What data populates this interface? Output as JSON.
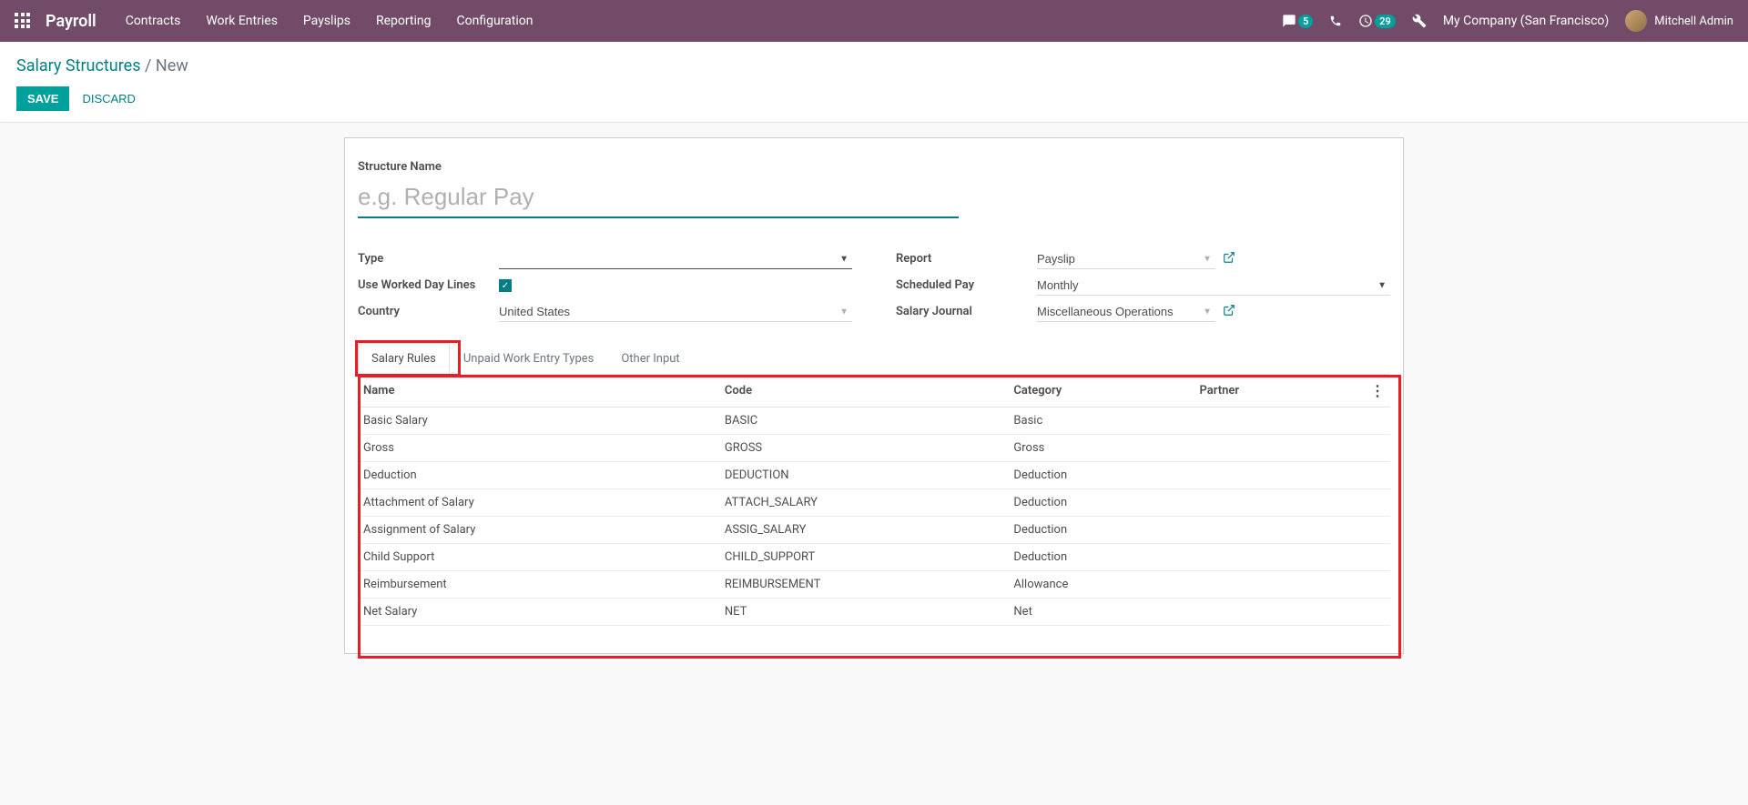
{
  "nav": {
    "brand": "Payroll",
    "items": [
      "Contracts",
      "Work Entries",
      "Payslips",
      "Reporting",
      "Configuration"
    ],
    "chat_badge": "5",
    "activity_badge": "29",
    "company": "My Company (San Francisco)",
    "user": "Mitchell Admin"
  },
  "breadcrumb": {
    "root": "Salary Structures",
    "separator": "/",
    "current": "New"
  },
  "actions": {
    "save": "Save",
    "discard": "Discard"
  },
  "form": {
    "structure_name_label": "Structure Name",
    "structure_name_placeholder": "e.g. Regular Pay",
    "left": {
      "type_label": "Type",
      "type_value": "",
      "use_worked_label": "Use Worked Day Lines",
      "country_label": "Country",
      "country_value": "United States"
    },
    "right": {
      "report_label": "Report",
      "report_value": "Payslip",
      "scheduled_label": "Scheduled Pay",
      "scheduled_value": "Monthly",
      "journal_label": "Salary Journal",
      "journal_value": "Miscellaneous Operations"
    }
  },
  "tabs": [
    "Salary Rules",
    "Unpaid Work Entry Types",
    "Other Input"
  ],
  "table": {
    "headers": [
      "Name",
      "Code",
      "Category",
      "Partner"
    ],
    "rows": [
      {
        "name": "Basic Salary",
        "code": "BASIC",
        "category": "Basic",
        "partner": ""
      },
      {
        "name": "Gross",
        "code": "GROSS",
        "category": "Gross",
        "partner": ""
      },
      {
        "name": "Deduction",
        "code": "DEDUCTION",
        "category": "Deduction",
        "partner": ""
      },
      {
        "name": "Attachment of Salary",
        "code": "ATTACH_SALARY",
        "category": "Deduction",
        "partner": ""
      },
      {
        "name": "Assignment of Salary",
        "code": "ASSIG_SALARY",
        "category": "Deduction",
        "partner": ""
      },
      {
        "name": "Child Support",
        "code": "CHILD_SUPPORT",
        "category": "Deduction",
        "partner": ""
      },
      {
        "name": "Reimbursement",
        "code": "REIMBURSEMENT",
        "category": "Allowance",
        "partner": ""
      },
      {
        "name": "Net Salary",
        "code": "NET",
        "category": "Net",
        "partner": ""
      }
    ]
  }
}
